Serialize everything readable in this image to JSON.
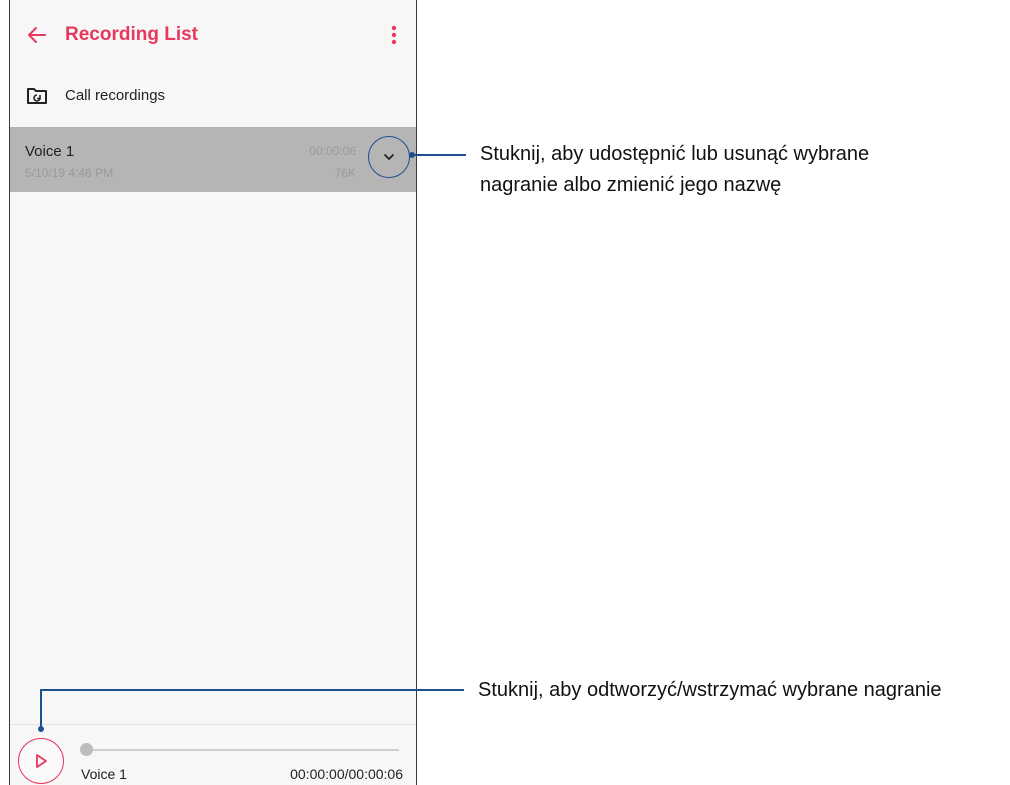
{
  "app": {
    "title": "Recording List",
    "back_icon": "arrow-left-icon",
    "menu_icon": "more-vert-icon",
    "accent_color": "#e8385d"
  },
  "folder": {
    "icon": "folder-sync-icon",
    "label": "Call recordings"
  },
  "recordings": [
    {
      "name": "Voice 1",
      "date": "5/10/19 4:48 PM",
      "duration": "00:00:06",
      "size": "76K",
      "expand_icon": "chevron-down-icon"
    }
  ],
  "player": {
    "play_icon": "play-icon",
    "track_name": "Voice 1",
    "time": "00:00:00/00:00:06",
    "progress": 0
  },
  "callouts": {
    "expand_line1": "Stuknij, aby udostępnić lub usunąć wybrane",
    "expand_line2": "nagranie albo zmienić jego nazwę",
    "play": "Stuknij, aby odtworzyć/wstrzymać wybrane nagranie",
    "color": "#1d4f91"
  }
}
